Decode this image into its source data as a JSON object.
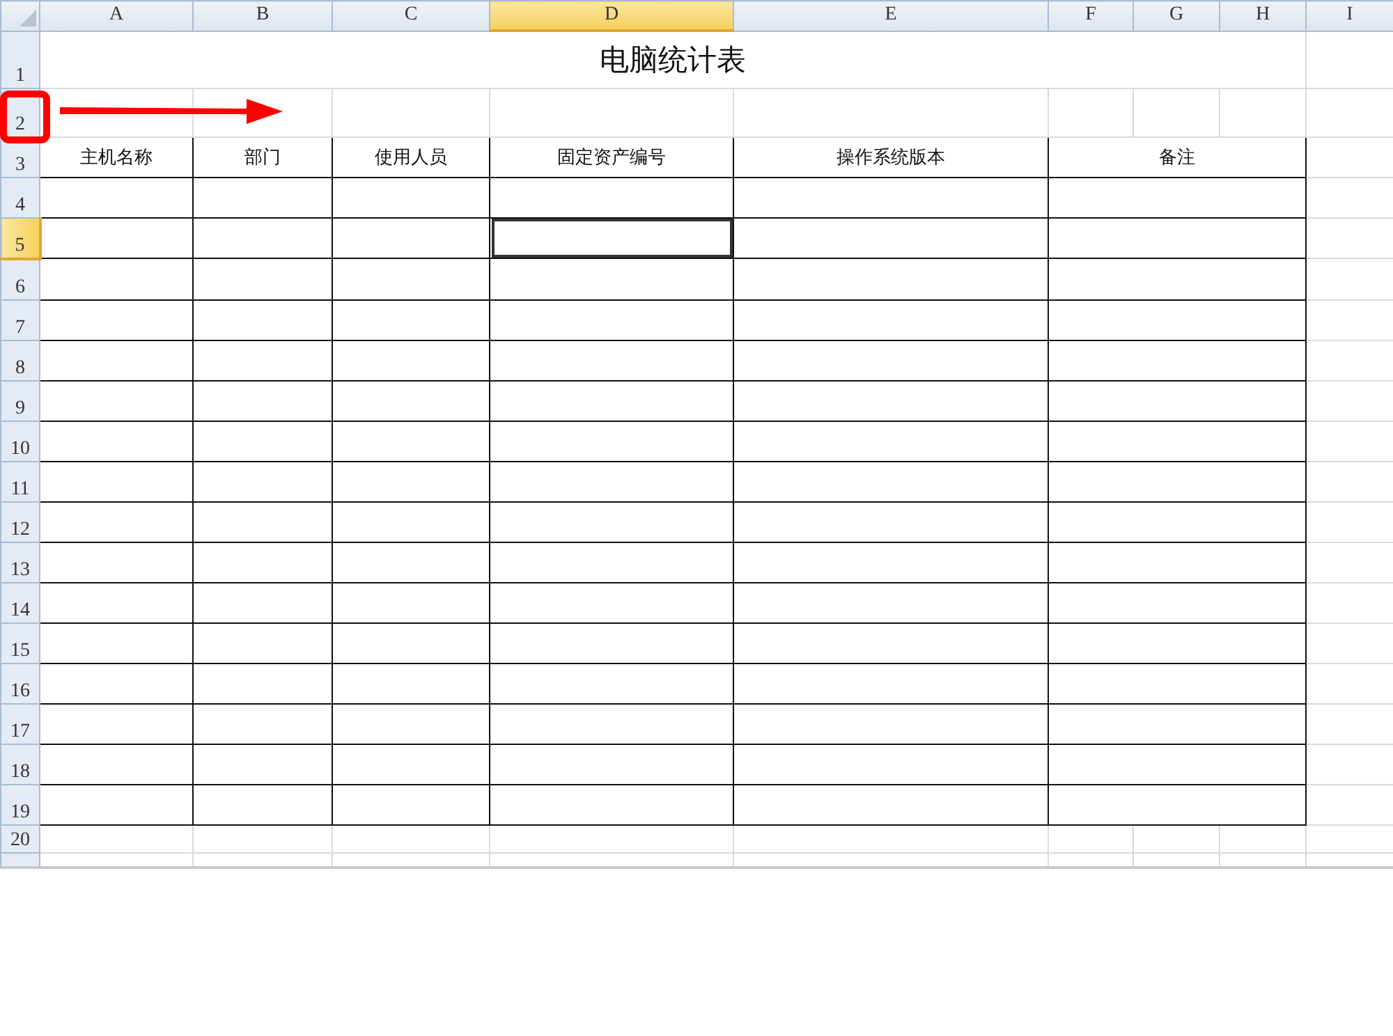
{
  "columns": [
    {
      "label": "A",
      "selected": false
    },
    {
      "label": "B",
      "selected": false
    },
    {
      "label": "C",
      "selected": false
    },
    {
      "label": "D",
      "selected": true
    },
    {
      "label": "E",
      "selected": false
    },
    {
      "label": "F",
      "selected": false
    },
    {
      "label": "G",
      "selected": false
    },
    {
      "label": "H",
      "selected": false
    },
    {
      "label": "I",
      "selected": false
    }
  ],
  "title": "电脑统计表",
  "headers": [
    "主机名称",
    "部门",
    "使用人员",
    "固定资产编号",
    "操作系统版本",
    "备注"
  ],
  "rows": [
    {
      "label": "1",
      "kind": "title",
      "selected": false
    },
    {
      "label": "2",
      "kind": "blank",
      "selected": false
    },
    {
      "label": "3",
      "kind": "header",
      "selected": false
    },
    {
      "label": "4",
      "kind": "data",
      "selected": false
    },
    {
      "label": "5",
      "kind": "data",
      "selected": true
    },
    {
      "label": "6",
      "kind": "data",
      "selected": false
    },
    {
      "label": "7",
      "kind": "data",
      "selected": false
    },
    {
      "label": "8",
      "kind": "data",
      "selected": false
    },
    {
      "label": "9",
      "kind": "data",
      "selected": false
    },
    {
      "label": "10",
      "kind": "data",
      "selected": false
    },
    {
      "label": "11",
      "kind": "data",
      "selected": false
    },
    {
      "label": "12",
      "kind": "data",
      "selected": false
    },
    {
      "label": "13",
      "kind": "data",
      "selected": false
    },
    {
      "label": "14",
      "kind": "data",
      "selected": false
    },
    {
      "label": "15",
      "kind": "data",
      "selected": false
    },
    {
      "label": "16",
      "kind": "data",
      "selected": false
    },
    {
      "label": "17",
      "kind": "data",
      "selected": false
    },
    {
      "label": "18",
      "kind": "data",
      "selected": false
    },
    {
      "label": "19",
      "kind": "data",
      "selected": false
    },
    {
      "label": "20",
      "kind": "blank",
      "selected": false
    }
  ]
}
